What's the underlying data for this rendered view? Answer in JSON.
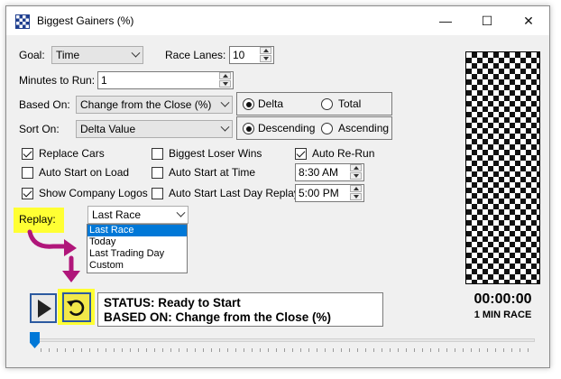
{
  "window": {
    "title": "Biggest Gainers (%)",
    "minimize": "—",
    "maximize": "☐",
    "close": "✕"
  },
  "goal": {
    "label": "Goal:",
    "value": "Time"
  },
  "race_lanes": {
    "label": "Race Lanes:",
    "value": "10"
  },
  "minutes": {
    "label": "Minutes to Run:",
    "value": "1"
  },
  "based_on": {
    "label": "Based On:",
    "value": "Change from the Close (%)"
  },
  "sort_on": {
    "label": "Sort On:",
    "value": "Delta Value"
  },
  "mode_group": {
    "delta": "Delta",
    "total": "Total",
    "selected": "delta"
  },
  "order_group": {
    "descending": "Descending",
    "ascending": "Ascending",
    "selected": "descending"
  },
  "checkboxes": {
    "replace_cars": {
      "label": "Replace Cars",
      "checked": true
    },
    "biggest_loser": {
      "label": "Biggest Loser Wins",
      "checked": false
    },
    "auto_rerun": {
      "label": "Auto Re-Run",
      "checked": true
    },
    "auto_start_load": {
      "label": "Auto Start on Load",
      "checked": false
    },
    "auto_start_time": {
      "label": "Auto Start at Time",
      "checked": false
    },
    "show_logos": {
      "label": "Show Company Logos",
      "checked": true
    },
    "auto_start_replay": {
      "label": "Auto Start Last Day Replay",
      "checked": false
    }
  },
  "times": {
    "start_time": "8:30 AM",
    "replay_time": "5:00 PM"
  },
  "replay": {
    "label": "Replay:",
    "selected": "Last Race",
    "options": [
      "Last Race",
      "Today",
      "Last Trading Day",
      "Custom"
    ]
  },
  "status": {
    "line1": "STATUS: Ready to Start",
    "line2": "BASED ON: Change from the Close (%)"
  },
  "timer": {
    "time": "00:00:00",
    "race": "1 MIN RACE"
  },
  "colors": {
    "highlight": "#ffff33",
    "arrow": "#b0167a",
    "accent": "#0078d7",
    "button_border": "#2c5aa0"
  },
  "progress": {
    "fraction": 0.0
  }
}
